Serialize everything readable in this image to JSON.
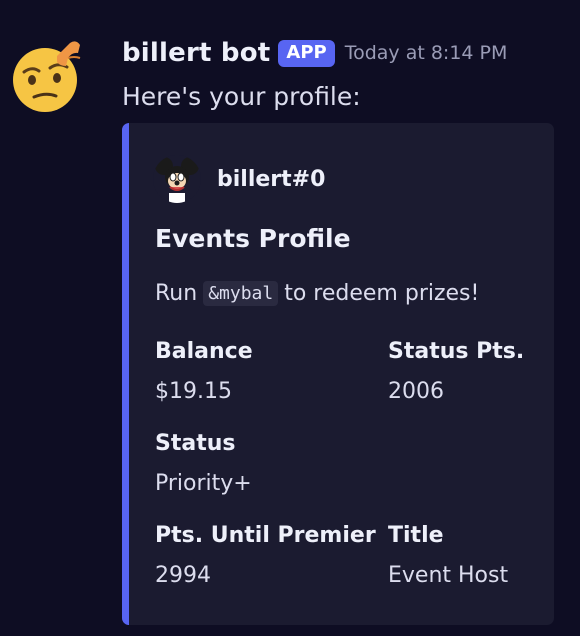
{
  "bot": {
    "username": "billert bot",
    "badge": "APP",
    "timestamp": "Today at 8:14 PM",
    "avatar_icon": "thinking-face-emoji"
  },
  "message": {
    "text": "Here's your profile:"
  },
  "embed": {
    "accent_color": "#5865f2",
    "author": {
      "name": "billert#0",
      "icon": "cartoon-mouse-avatar"
    },
    "title": "Events Profile",
    "description": {
      "before": "Run",
      "code": "&mybal",
      "after": "to redeem prizes!"
    },
    "fields": [
      {
        "name": "Balance",
        "value": "$19.15"
      },
      {
        "name": "Status Pts.",
        "value": "2006"
      },
      {
        "name": "Status",
        "value": "Priority+"
      },
      {
        "name": "Pts. Until Premier",
        "value": "2994"
      },
      {
        "name": "Title",
        "value": "Event Host"
      }
    ]
  }
}
